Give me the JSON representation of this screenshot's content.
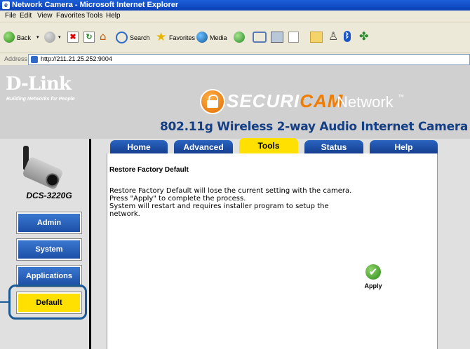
{
  "window": {
    "title": "Network Camera - Microsoft Internet Explorer"
  },
  "menu": [
    "File",
    "Edit",
    "View",
    "Favorites",
    "Tools",
    "Help"
  ],
  "toolbar": {
    "back": "Back",
    "search": "Search",
    "favorites": "Favorites",
    "media": "Media"
  },
  "address": {
    "label": "Address",
    "url": "http://211.21.25.252:9004"
  },
  "header": {
    "logo": "D-Link",
    "tagline": "Building Networks for People",
    "product_part1": "SECURI",
    "product_part2": "CAM",
    "product_part3": "Network",
    "tm": "™",
    "subtitle": "802.11g Wireless 2-way Audio Internet Camera"
  },
  "tabs": [
    {
      "label": "Home",
      "active": false
    },
    {
      "label": "Advanced",
      "active": false
    },
    {
      "label": "Tools",
      "active": true
    },
    {
      "label": "Status",
      "active": false
    },
    {
      "label": "Help",
      "active": false
    }
  ],
  "sidebar": {
    "model": "DCS-3220G",
    "items": [
      {
        "label": "Admin",
        "active": false
      },
      {
        "label": "System",
        "active": false
      },
      {
        "label": "Applications",
        "active": false
      },
      {
        "label": "Default",
        "active": true
      }
    ]
  },
  "content": {
    "heading": "Restore Factory Default",
    "lines": [
      "Restore Factory Default will lose the current setting with the camera.",
      "Press \"Apply\" to complete the process.",
      "System will restart and requires installer program to setup the",
      "network."
    ],
    "apply_label": "Apply"
  },
  "colors": {
    "accent": "#ffe000",
    "tab_blue": "#1d4fa6",
    "highlight": "#1a5a96",
    "logo_orange": "#f07d00"
  }
}
